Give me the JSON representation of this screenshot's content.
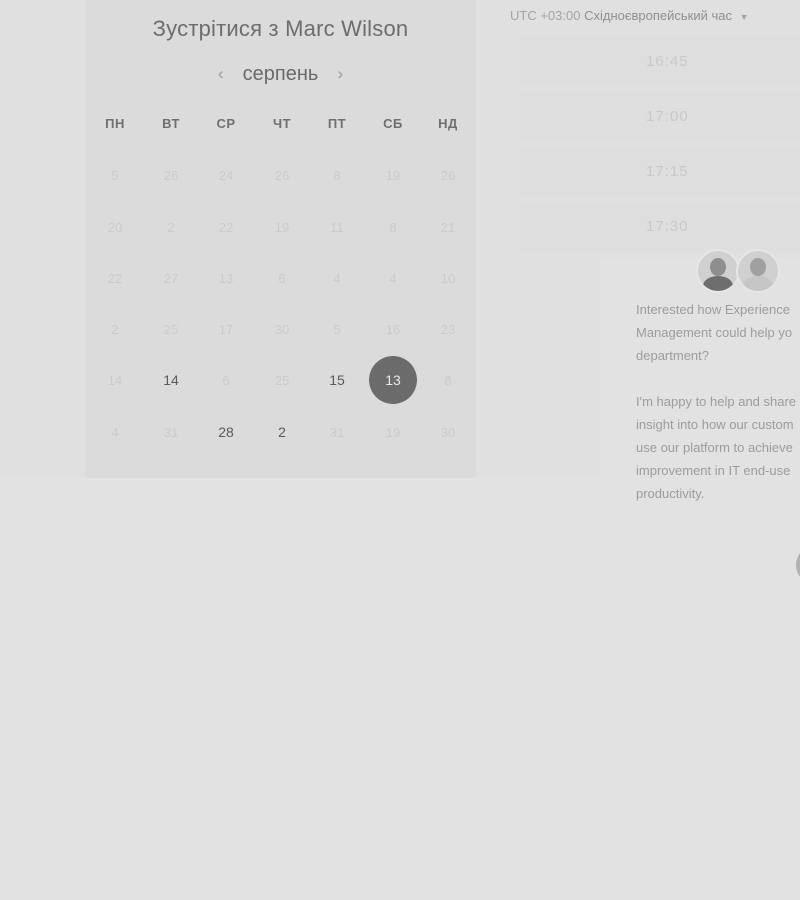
{
  "calendar": {
    "title": "Зустрітися з Marc Wilson",
    "month": "серпень",
    "weekdays": [
      "ПН",
      "ВТ",
      "СР",
      "ЧТ",
      "ПТ",
      "СБ",
      "НД"
    ],
    "weeks": [
      [
        {
          "label": "5",
          "state": "disabled"
        },
        {
          "label": "26",
          "state": "disabled"
        },
        {
          "label": "24",
          "state": "disabled"
        },
        {
          "label": "26",
          "state": "disabled"
        },
        {
          "label": "8",
          "state": "disabled"
        },
        {
          "label": "19",
          "state": "disabled"
        },
        {
          "label": "26",
          "state": "disabled"
        }
      ],
      [
        {
          "label": "20",
          "state": "disabled"
        },
        {
          "label": "2",
          "state": "disabled"
        },
        {
          "label": "22",
          "state": "disabled"
        },
        {
          "label": "19",
          "state": "disabled"
        },
        {
          "label": "11",
          "state": "disabled"
        },
        {
          "label": "8",
          "state": "disabled"
        },
        {
          "label": "21",
          "state": "disabled"
        }
      ],
      [
        {
          "label": "22",
          "state": "disabled"
        },
        {
          "label": "27",
          "state": "disabled"
        },
        {
          "label": "13",
          "state": "disabled"
        },
        {
          "label": "6",
          "state": "disabled"
        },
        {
          "label": "4",
          "state": "disabled"
        },
        {
          "label": "4",
          "state": "disabled"
        },
        {
          "label": "10",
          "state": "disabled"
        }
      ],
      [
        {
          "label": "2",
          "state": "disabled"
        },
        {
          "label": "25",
          "state": "disabled"
        },
        {
          "label": "17",
          "state": "disabled"
        },
        {
          "label": "30",
          "state": "disabled"
        },
        {
          "label": "5",
          "state": "disabled"
        },
        {
          "label": "16",
          "state": "disabled"
        },
        {
          "label": "23",
          "state": "disabled"
        }
      ],
      [
        {
          "label": "14",
          "state": "disabled"
        },
        {
          "label": "14",
          "state": "available"
        },
        {
          "label": "6",
          "state": "disabled"
        },
        {
          "label": "25",
          "state": "disabled"
        },
        {
          "label": "15",
          "state": "available"
        },
        {
          "label": "13",
          "state": "selected"
        },
        {
          "label": "8",
          "state": "disabled"
        }
      ],
      [
        {
          "label": "4",
          "state": "disabled"
        },
        {
          "label": "31",
          "state": "disabled"
        },
        {
          "label": "28",
          "state": "available"
        },
        {
          "label": "2",
          "state": "available"
        },
        {
          "label": "31",
          "state": "disabled"
        },
        {
          "label": "19",
          "state": "disabled"
        },
        {
          "label": "30",
          "state": "disabled"
        }
      ]
    ]
  },
  "timezone": {
    "offset": "UTC +03:00",
    "name": "Східноєвропейський час"
  },
  "time_slots": [
    "16:45",
    "17:00",
    "17:15",
    "17:30"
  ],
  "chat": {
    "message": "Interested how Experience\nManagement could help yo\ndepartment?\n\nI'm happy to help and share\ninsight into how our custom\nuse our platform to achieve\nimprovement in IT end-use\nproductivity."
  },
  "colors": {
    "overlay_background": "#e2e2e2",
    "calendar_background": "#dbdbdb",
    "selected_day": "#6b6b6b"
  },
  "icons": {
    "prev_month": "chevron-left-icon",
    "next_month": "chevron-right-icon",
    "timezone_dropdown": "caret-down-icon",
    "chat_launcher": "chat-bubble-icon"
  }
}
